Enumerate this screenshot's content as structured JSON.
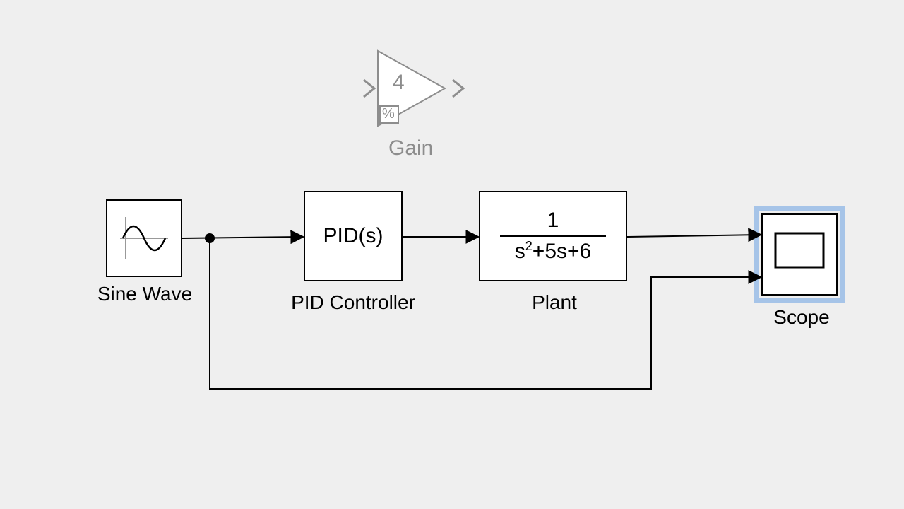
{
  "blocks": {
    "sineWave": {
      "label": "Sine Wave"
    },
    "gain": {
      "label": "Gain",
      "value": "4",
      "badge": "%"
    },
    "pid": {
      "label": "PID Controller",
      "display": "PID(s)"
    },
    "plant": {
      "label": "Plant",
      "numerator": "1",
      "denominator_prefix": "s",
      "denominator_exp": "2",
      "denominator_suffix": "+5s+6"
    },
    "scope": {
      "label": "Scope"
    }
  },
  "colors": {
    "selection": "#a6c4e8",
    "ghost": "#8d8d8d"
  }
}
